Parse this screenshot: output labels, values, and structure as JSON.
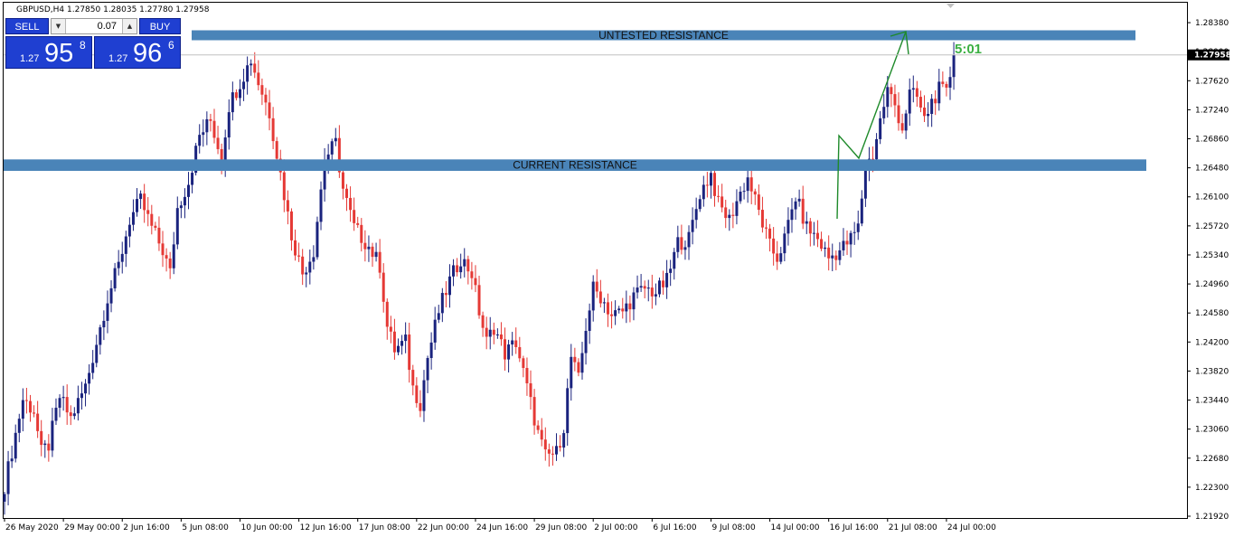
{
  "header": {
    "symbol_text": "GBPUSD,H4  1.27850 1.28035 1.27780 1.27958"
  },
  "trade_panel": {
    "sell_label": "SELL",
    "buy_label": "BUY",
    "lot": "0.07",
    "sell_price": {
      "prefix": "1.27",
      "big": "95",
      "sup": "8"
    },
    "buy_price": {
      "prefix": "1.27",
      "big": "96",
      "sup": "6"
    },
    "down_arrow": "▼",
    "up_arrow": "▲"
  },
  "chart_data": {
    "type": "candlestick",
    "symbol": "GBPUSD",
    "timeframe": "H4",
    "ylim": [
      1.2192,
      1.2857
    ],
    "y_ticks": [
      "1.28380",
      "1.28000",
      "1.27620",
      "1.27240",
      "1.26860",
      "1.26480",
      "1.26100",
      "1.25720",
      "1.25340",
      "1.24960",
      "1.24580",
      "1.24200",
      "1.23820",
      "1.23440",
      "1.23060",
      "1.22680",
      "1.22300",
      "1.21920"
    ],
    "x_ticks": [
      {
        "label": "26 May 2020",
        "index": 0
      },
      {
        "label": "29 May 00:00",
        "index": 16
      },
      {
        "label": "2 Jun 16:00",
        "index": 32
      },
      {
        "label": "5 Jun 08:00",
        "index": 48
      },
      {
        "label": "10 Jun 00:00",
        "index": 64
      },
      {
        "label": "12 Jun 16:00",
        "index": 80
      },
      {
        "label": "17 Jun 08:00",
        "index": 96
      },
      {
        "label": "22 Jun 00:00",
        "index": 112
      },
      {
        "label": "24 Jun 16:00",
        "index": 128
      },
      {
        "label": "29 Jun 08:00",
        "index": 144
      },
      {
        "label": "2 Jul 00:00",
        "index": 160
      },
      {
        "label": "6 Jul 16:00",
        "index": 176
      },
      {
        "label": "9 Jul 08:00",
        "index": 192
      },
      {
        "label": "14 Jul 00:00",
        "index": 208
      },
      {
        "label": "16 Jul 16:00",
        "index": 224
      },
      {
        "label": "21 Jul 08:00",
        "index": 240
      },
      {
        "label": "24 Jul 00:00",
        "index": 256
      }
    ],
    "anchors": [
      [
        0,
        1.2232
      ],
      [
        5,
        1.2345
      ],
      [
        8,
        1.233
      ],
      [
        10,
        1.2275
      ],
      [
        12,
        1.2285
      ],
      [
        15,
        1.2348
      ],
      [
        18,
        1.232
      ],
      [
        22,
        1.2362
      ],
      [
        25,
        1.242
      ],
      [
        28,
        1.2478
      ],
      [
        31,
        1.252
      ],
      [
        34,
        1.258
      ],
      [
        37,
        1.2605
      ],
      [
        40,
        1.257
      ],
      [
        43,
        1.254
      ],
      [
        45,
        1.251
      ],
      [
        47,
        1.2595
      ],
      [
        50,
        1.263
      ],
      [
        53,
        1.269
      ],
      [
        56,
        1.271
      ],
      [
        59,
        1.266
      ],
      [
        61,
        1.273
      ],
      [
        64,
        1.276
      ],
      [
        67,
        1.279
      ],
      [
        69,
        1.276
      ],
      [
        72,
        1.272
      ],
      [
        75,
        1.264
      ],
      [
        78,
        1.256
      ],
      [
        81,
        1.251
      ],
      [
        84,
        1.254
      ],
      [
        87,
        1.266
      ],
      [
        90,
        1.268
      ],
      [
        92,
        1.262
      ],
      [
        95,
        1.257
      ],
      [
        99,
        1.2545
      ],
      [
        102,
        1.252
      ],
      [
        104,
        1.244
      ],
      [
        106,
        1.241
      ],
      [
        109,
        1.242
      ],
      [
        111,
        1.236
      ],
      [
        113,
        1.234
      ],
      [
        115,
        1.24
      ],
      [
        118,
        1.246
      ],
      [
        121,
        1.25
      ],
      [
        124,
        1.253
      ],
      [
        127,
        1.251
      ],
      [
        129,
        1.246
      ],
      [
        131,
        1.242
      ],
      [
        133,
        1.244
      ],
      [
        136,
        1.2405
      ],
      [
        139,
        1.242
      ],
      [
        141,
        1.238
      ],
      [
        143,
        1.234
      ],
      [
        145,
        1.23
      ],
      [
        147,
        1.227
      ],
      [
        150,
        1.2275
      ],
      [
        152,
        1.231
      ],
      [
        154,
        1.24
      ],
      [
        156,
        1.237
      ],
      [
        158,
        1.244
      ],
      [
        160,
        1.249
      ],
      [
        162,
        1.248
      ],
      [
        165,
        1.2455
      ],
      [
        168,
        1.246
      ],
      [
        171,
        1.248
      ],
      [
        174,
        1.249
      ],
      [
        177,
        1.2485
      ],
      [
        180,
        1.25
      ],
      [
        183,
        1.255
      ],
      [
        186,
        1.2555
      ],
      [
        189,
        1.2615
      ],
      [
        192,
        1.264
      ],
      [
        194,
        1.26
      ],
      [
        197,
        1.258
      ],
      [
        199,
        1.2605
      ],
      [
        202,
        1.2635
      ],
      [
        205,
        1.259
      ],
      [
        208,
        1.2545
      ],
      [
        210,
        1.253
      ],
      [
        212,
        1.2555
      ],
      [
        215,
        1.261
      ],
      [
        218,
        1.257
      ],
      [
        221,
        1.2555
      ],
      [
        224,
        1.253
      ],
      [
        227,
        1.254
      ],
      [
        230,
        1.2555
      ],
      [
        232,
        1.257
      ],
      [
        234,
        1.265
      ],
      [
        236,
        1.2665
      ],
      [
        238,
        1.271
      ],
      [
        240,
        1.275
      ],
      [
        242,
        1.273
      ],
      [
        244,
        1.27
      ],
      [
        246,
        1.2745
      ],
      [
        248,
        1.274
      ],
      [
        250,
        1.271
      ],
      [
        252,
        1.2735
      ],
      [
        254,
        1.275
      ],
      [
        256,
        1.2745
      ],
      [
        258,
        1.2795
      ]
    ],
    "last_close": 1.27958,
    "zones": [
      {
        "label": "UNTESTED RESISTANCE",
        "low": 1.2815,
        "high": 1.2828
      },
      {
        "label": "CURRENT RESISTANCE",
        "low": 1.2644,
        "high": 1.2659
      }
    ],
    "countdown": "5:01",
    "colors": {
      "bull": "#1a237e",
      "bear": "#e53935",
      "zone": "#4a84b8",
      "arrow": "#1e8a2a",
      "countdown": "#3cb043"
    }
  }
}
